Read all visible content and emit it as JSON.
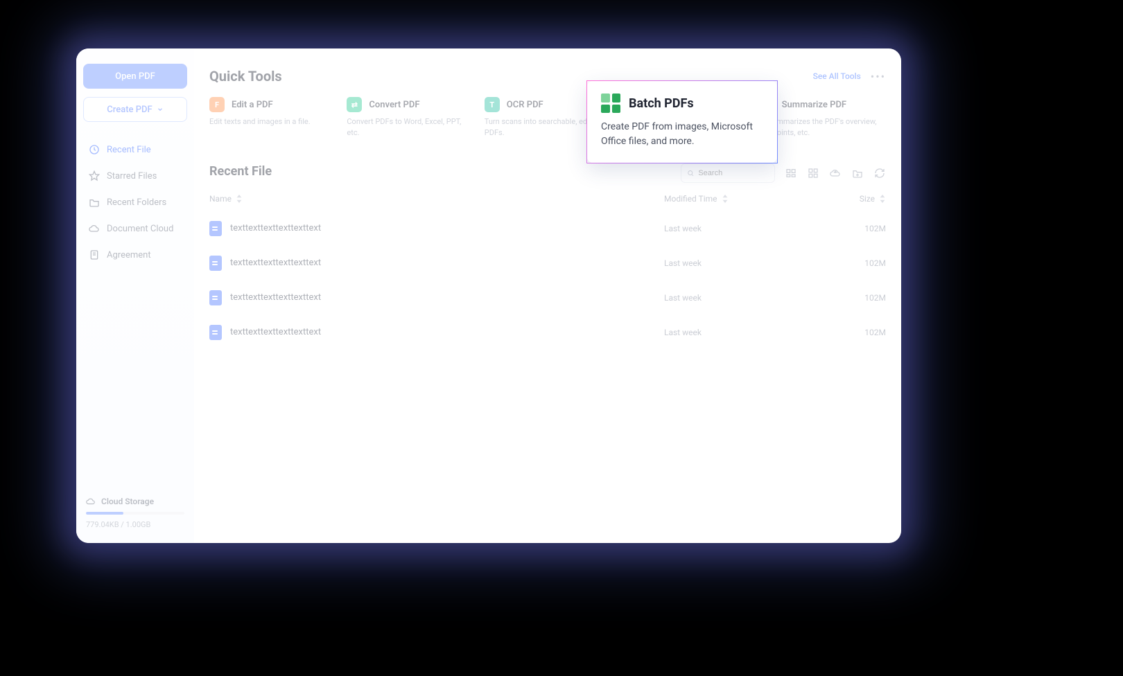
{
  "sidebar": {
    "open_label": "Open PDF",
    "create_label": "Create PDF",
    "nav": [
      {
        "label": "Recent File"
      },
      {
        "label": "Starred Files"
      },
      {
        "label": "Recent Folders"
      },
      {
        "label": "Document Cloud"
      },
      {
        "label": "Agreement"
      }
    ],
    "storage": {
      "title": "Cloud Storage",
      "text": "779.04KB / 1.00GB"
    }
  },
  "header": {
    "title": "Quick Tools",
    "see_all": "See All Tools"
  },
  "tools": [
    {
      "title": "Edit a PDF",
      "desc": "Edit texts and images in a file.",
      "color": "#ff9a5a"
    },
    {
      "title": "Convert PDF",
      "desc": "Convert PDFs to Word, Excel, PPT, etc.",
      "color": "#3bcf9c"
    },
    {
      "title": "OCR PDF",
      "desc": "Turn scans into searchable, editable PDFs.",
      "color": "#36c3a8"
    },
    {
      "title": "Batch PDFs",
      "desc": "Create PDF from images, Microsoft Office files, and more.",
      "color": "#2aa85a"
    },
    {
      "title": "Summarize PDF",
      "desc": "AI summarizes the PDF's overview, key points, etc.",
      "color": "#8a7dff"
    }
  ],
  "recent": {
    "title": "Recent File",
    "search_placeholder": "Search",
    "columns": {
      "name": "Name",
      "modified": "Modified Time",
      "size": "Size"
    },
    "rows": [
      {
        "name": "texttexttexttexttexttext",
        "modified": "Last week",
        "size": "102M"
      },
      {
        "name": "texttexttexttexttexttext",
        "modified": "Last week",
        "size": "102M"
      },
      {
        "name": "texttexttexttexttexttext",
        "modified": "Last week",
        "size": "102M"
      },
      {
        "name": "texttexttexttexttexttext",
        "modified": "Last week",
        "size": "102M"
      }
    ]
  },
  "popover": {
    "title": "Batch PDFs",
    "desc": "Create PDF from images, Microsoft Office files, and more."
  }
}
